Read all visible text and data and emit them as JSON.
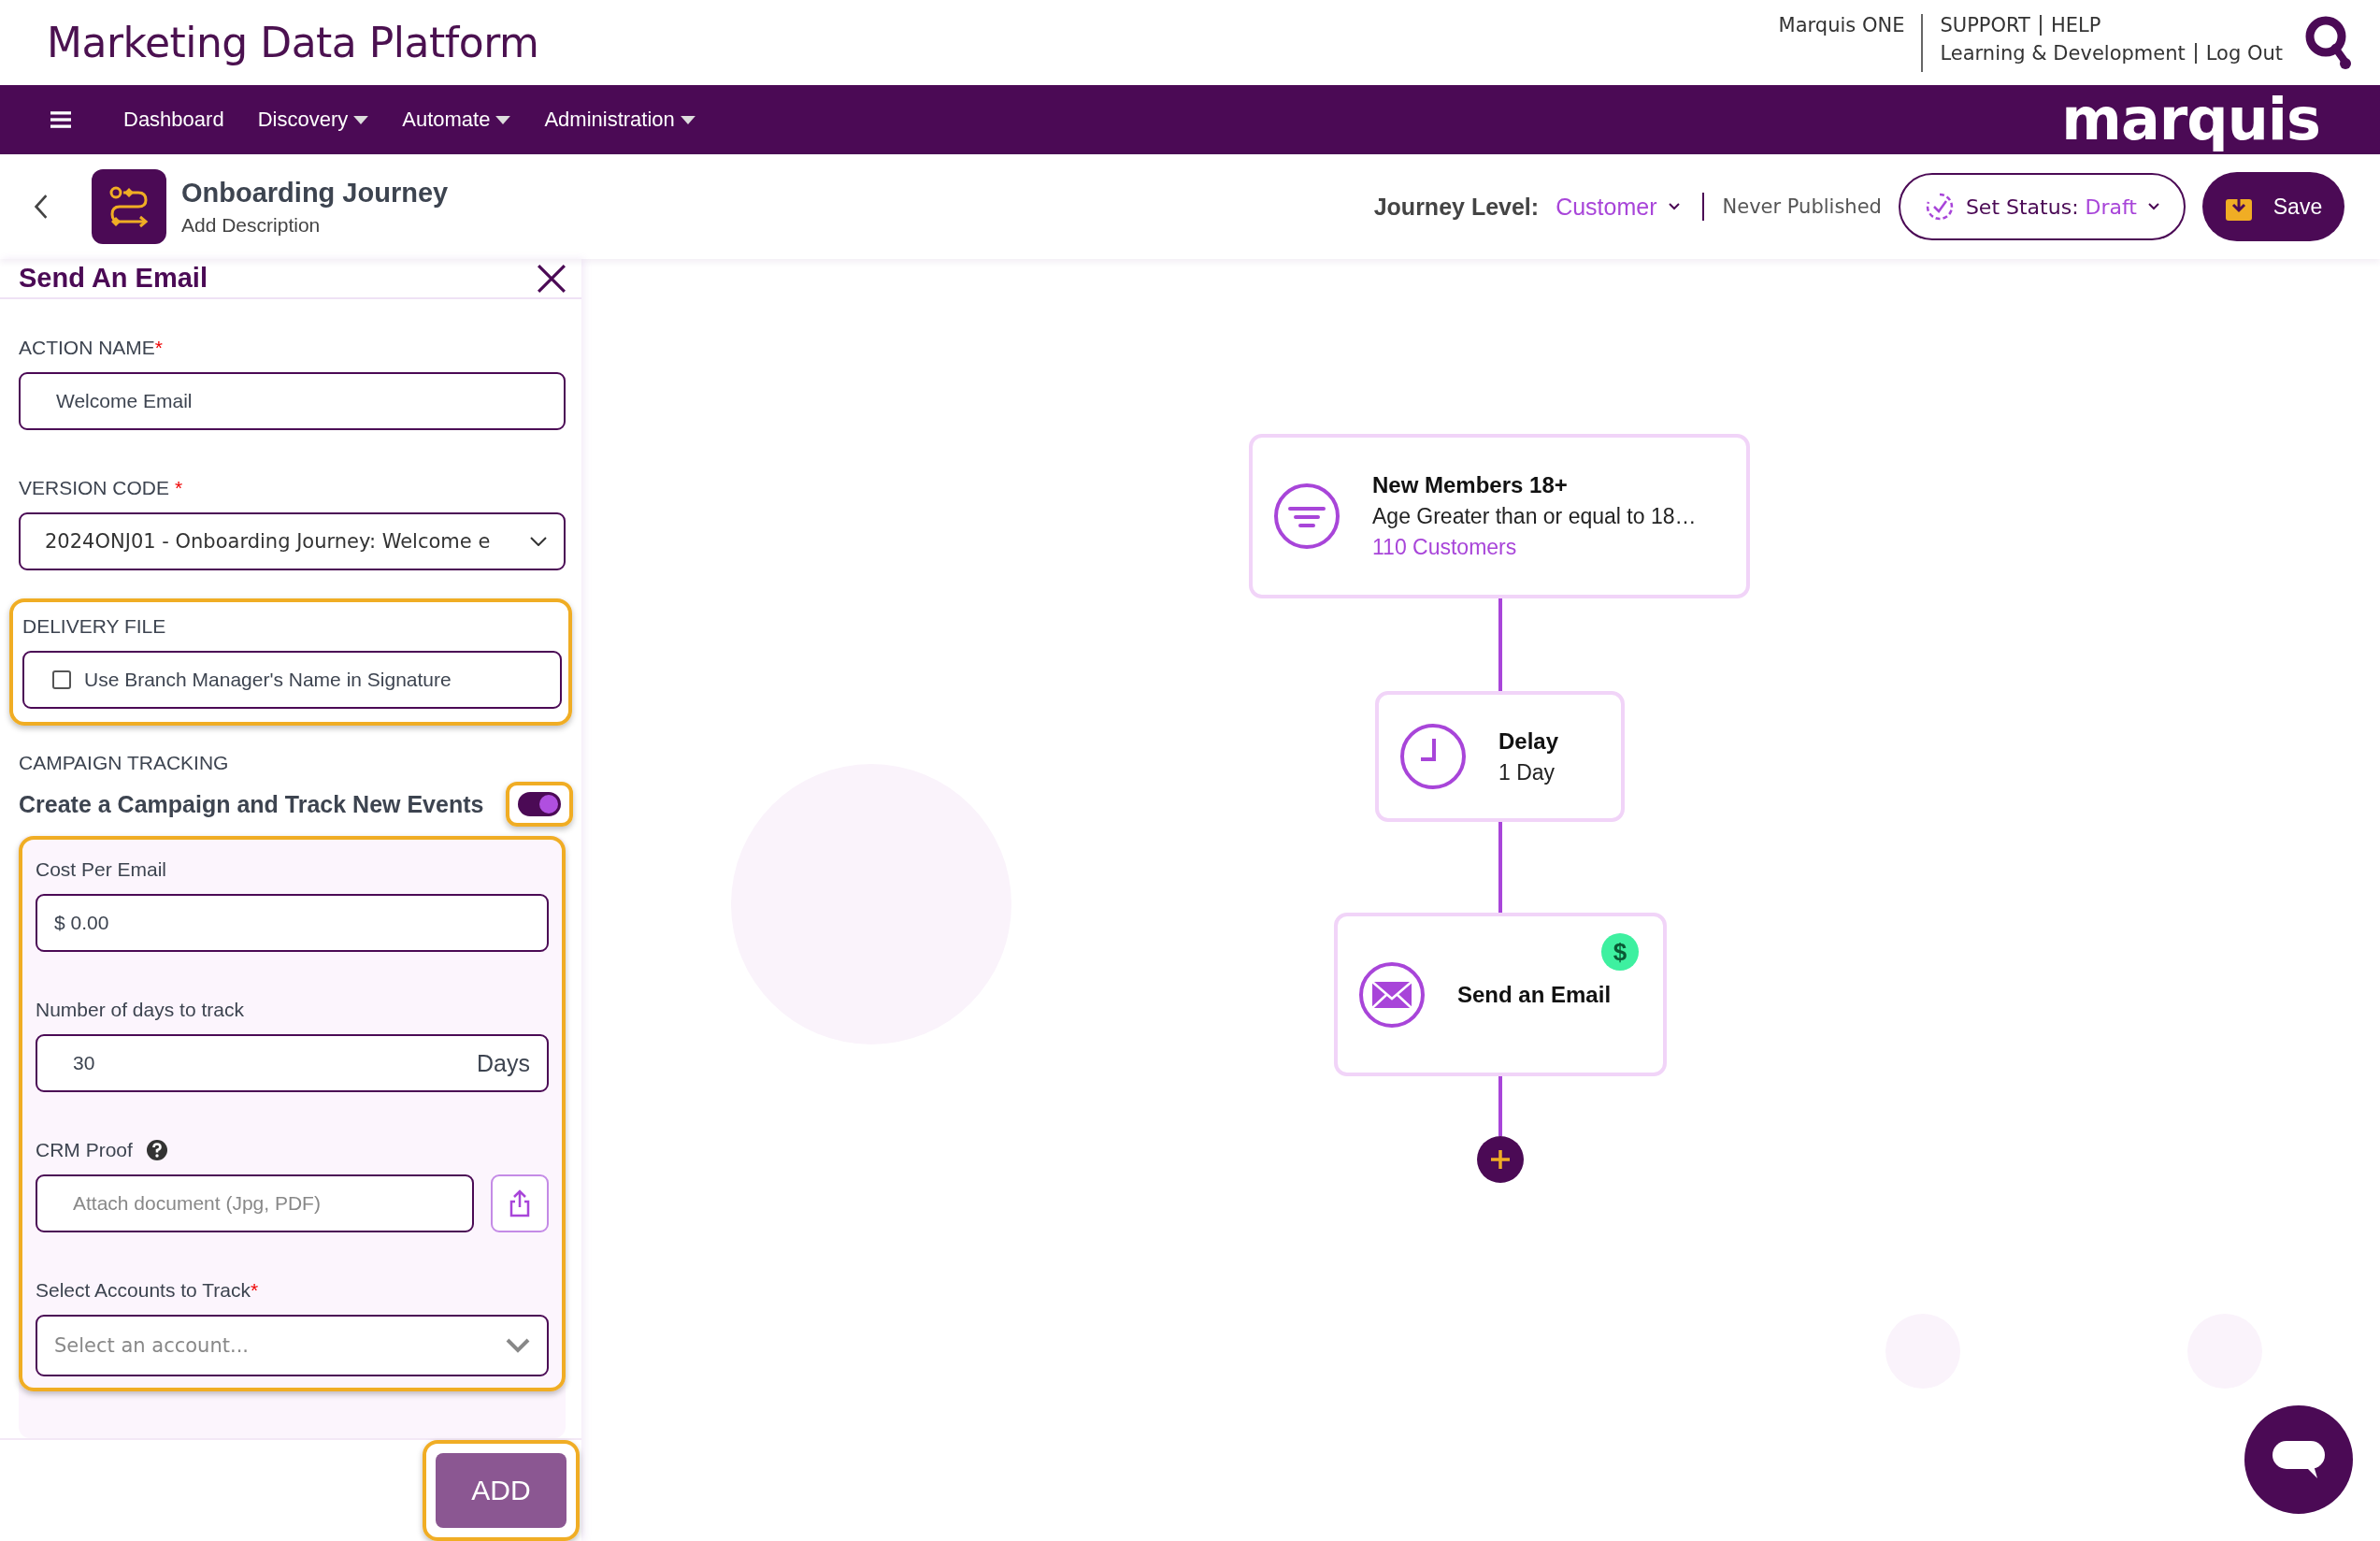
{
  "header": {
    "title": "Marketing Data Platform",
    "marquis_one": "Marquis ONE",
    "support": "SUPPORT",
    "help": "HELP",
    "learning": "Learning & Development",
    "logout": "Log Out"
  },
  "nav": {
    "items": [
      {
        "label": "Dashboard",
        "dropdown": false
      },
      {
        "label": "Discovery",
        "dropdown": true
      },
      {
        "label": "Automate",
        "dropdown": true
      },
      {
        "label": "Administration",
        "dropdown": true
      }
    ],
    "logo": "marquis"
  },
  "journey": {
    "title": "Onboarding Journey",
    "description": "Add Description",
    "level_label": "Journey Level:",
    "level": "Customer",
    "publish_status": "Never Published",
    "status_label": "Set Status:",
    "status": "Draft",
    "save": "Save"
  },
  "panel": {
    "title": "Send An Email",
    "action_name": {
      "label": "ACTION NAME",
      "required_mark": "*",
      "value": "Welcome Email"
    },
    "version_code": {
      "label": "VERSION CODE",
      "required_mark": "*",
      "value": "2024ONJ01 - Onboarding Journey: Welcome e"
    },
    "delivery_file": {
      "label": "DELIVERY FILE",
      "highlighted": true,
      "option": "Use Branch Manager's Name in Signature",
      "checked": false
    },
    "campaign_tracking": {
      "label": "CAMPAIGN TRACKING",
      "toggle_label": "Create a Campaign and Track New Events",
      "on": true,
      "toggle_highlighted": true,
      "highlighted": true,
      "cost": {
        "label": "Cost Per Email",
        "prefix": "$",
        "value": "0.00"
      },
      "days": {
        "label": "Number of days to track",
        "value": "30",
        "suffix": "Days"
      },
      "crm_proof": {
        "label": "CRM Proof",
        "placeholder": "Attach document (Jpg, PDF)"
      },
      "accounts": {
        "label": "Select Accounts to Track",
        "required_mark": "*",
        "placeholder": "Select an account..."
      }
    },
    "add_button": {
      "label": "ADD",
      "highlighted": true
    }
  },
  "canvas": {
    "nodes": [
      {
        "kind": "segment",
        "title": "New Members 18+",
        "detail": "Age Greater than or equal to 18…",
        "count": "110 Customers"
      },
      {
        "kind": "delay",
        "title": "Delay",
        "detail": "1 Day"
      },
      {
        "kind": "email",
        "title": "Send an Email",
        "badge": "$"
      }
    ]
  }
}
